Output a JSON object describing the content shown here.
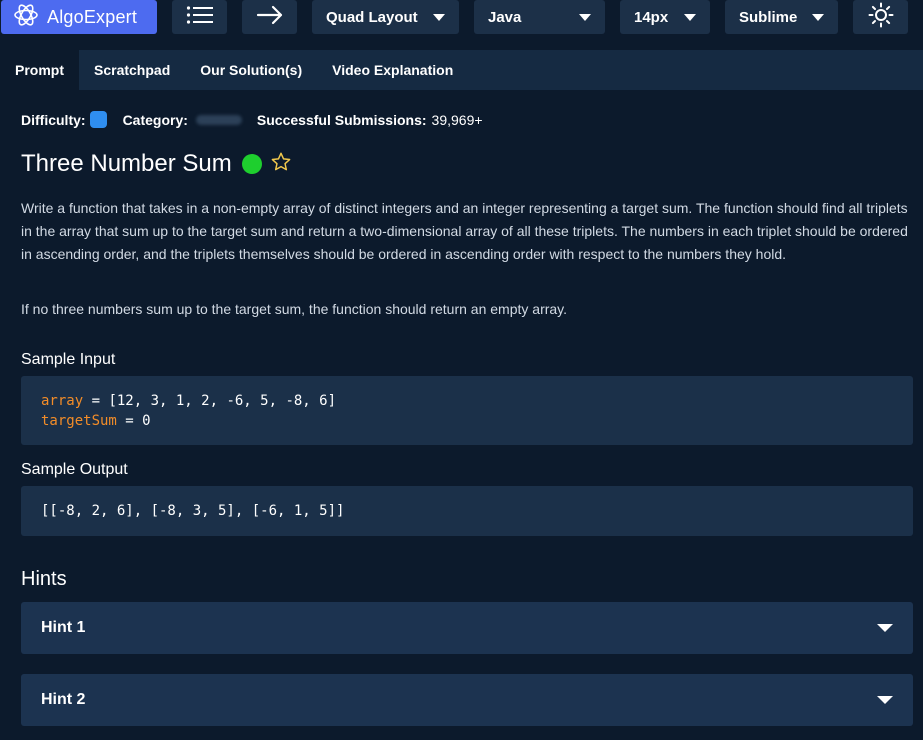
{
  "toolbar": {
    "logo_text": "AlgoExpert",
    "layout": "Quad Layout",
    "language": "Java",
    "font_size": "14px",
    "keymap": "Sublime"
  },
  "tabs": [
    {
      "label": "Prompt",
      "active": true
    },
    {
      "label": "Scratchpad",
      "active": false
    },
    {
      "label": "Our Solution(s)",
      "active": false
    },
    {
      "label": "Video Explanation",
      "active": false
    }
  ],
  "meta": {
    "difficulty_label": "Difficulty:",
    "category_label": "Category:",
    "submissions_label": "Successful Submissions:",
    "submissions_value": "39,969+"
  },
  "problem": {
    "title": "Three Number Sum",
    "paragraph1": "Write a function that takes in a non-empty array of distinct integers and an integer representing a target sum. The function should find all triplets in the array that sum up to the target sum and return a two-dimensional array of all these triplets. The numbers in each triplet should be ordered in ascending order, and the triplets themselves should be ordered in ascending order with respect to the numbers they hold.",
    "paragraph2": "If no three numbers sum up to the target sum, the function should return an empty array."
  },
  "sample_input": {
    "heading": "Sample Input",
    "line1_var": "array",
    "line1_rest": " = [12, 3, 1, 2, -6, 5, -8, 6]",
    "line2_var": "targetSum",
    "line2_rest": " = 0"
  },
  "sample_output": {
    "heading": "Sample Output",
    "value": "[[-8, 2, 6], [-8, 3, 5], [-6, 1, 5]]"
  },
  "hints": {
    "heading": "Hints",
    "items": [
      {
        "label": "Hint 1"
      },
      {
        "label": "Hint 2"
      }
    ]
  },
  "icons": [
    "algoexpert-logo-icon",
    "list-icon",
    "arrow-right-icon",
    "caret-down-icon",
    "sun-icon",
    "star-icon"
  ],
  "colors": {
    "background": "#0c1a2c",
    "logo_button": "#4d6bf0",
    "difficulty": "#2f8ef0",
    "completed_dot": "#1ecf2e",
    "star": "#f2c94c",
    "code_variable": "#f28c28"
  }
}
